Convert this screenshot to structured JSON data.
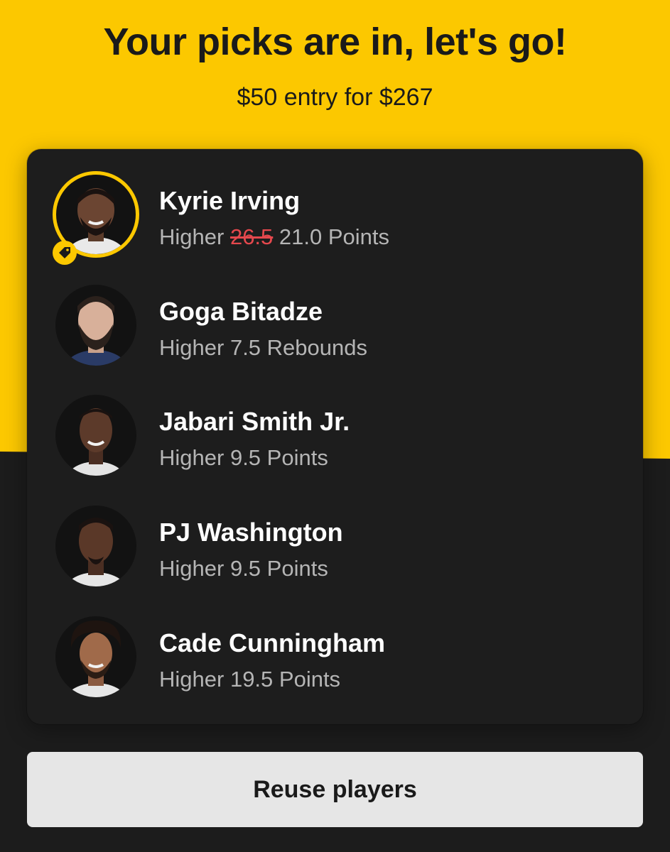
{
  "header": {
    "title": "Your picks are in, let's go!",
    "entry_summary": "$50 entry for $267"
  },
  "picks": [
    {
      "name": "Kyrie Irving",
      "direction": "Higher",
      "original_line": "26.5",
      "line": "21.0 Points",
      "discounted": true
    },
    {
      "name": "Goga Bitadze",
      "direction": "Higher",
      "line": "7.5 Rebounds",
      "discounted": false
    },
    {
      "name": "Jabari Smith Jr.",
      "direction": "Higher",
      "line": "9.5 Points",
      "discounted": false
    },
    {
      "name": "PJ Washington",
      "direction": "Higher",
      "line": "9.5 Points",
      "discounted": false
    },
    {
      "name": "Cade Cunningham",
      "direction": "Higher",
      "line": "19.5 Points",
      "discounted": false
    }
  ],
  "actions": {
    "reuse_label": "Reuse players"
  },
  "colors": {
    "brand_yellow": "#fcc800",
    "card_bg": "#1d1d1d",
    "strike_red": "#e5484d",
    "button_bg": "#e6e6e6"
  },
  "icons": {
    "discount": "price-tag-icon"
  }
}
